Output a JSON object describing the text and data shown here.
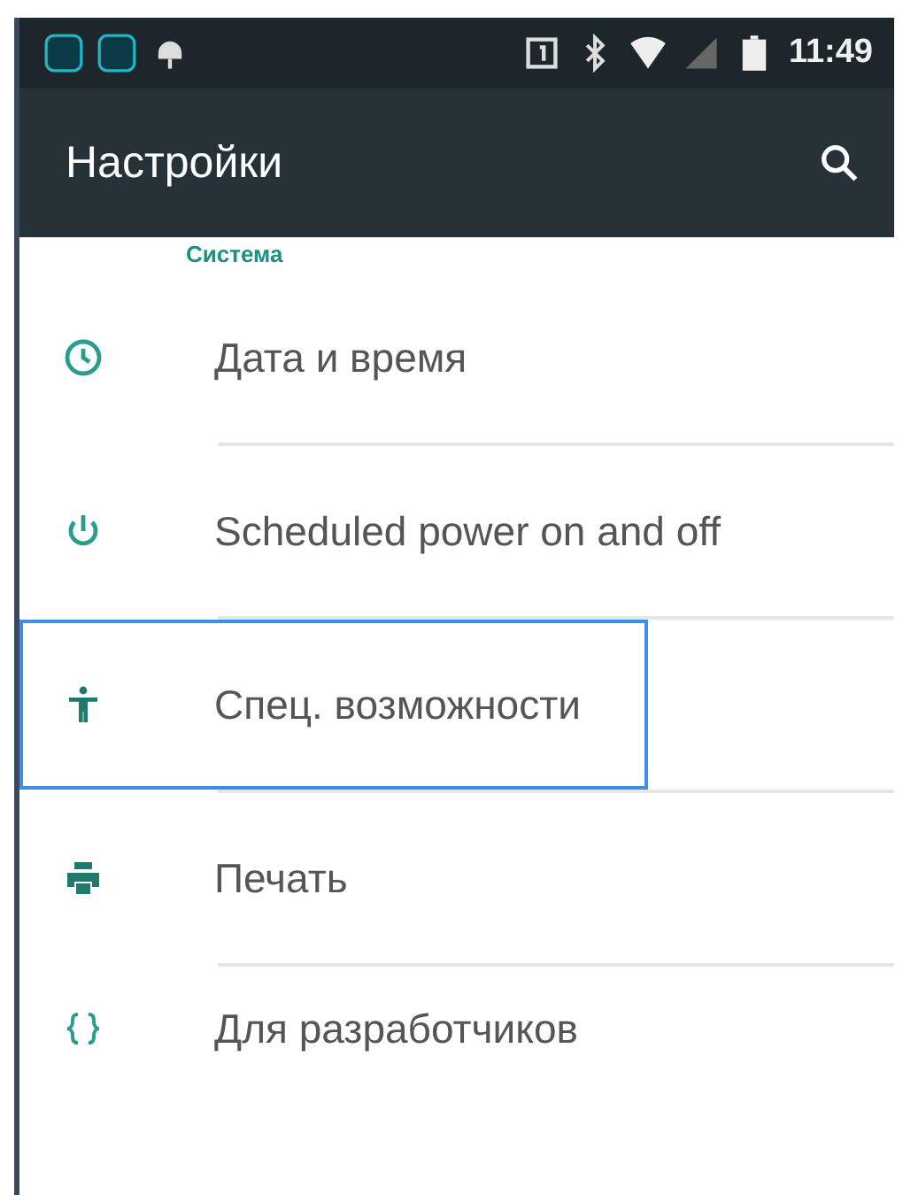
{
  "status_bar": {
    "time": "11:49"
  },
  "toolbar": {
    "title": "Настройки"
  },
  "section": {
    "title": "Система"
  },
  "items": [
    {
      "label": "Дата и время",
      "focused": false
    },
    {
      "label": "Scheduled power on and off",
      "focused": false
    },
    {
      "label": "Спец. возможности",
      "focused": true
    },
    {
      "label": "Печать",
      "focused": false
    },
    {
      "label": "Для разработчиков",
      "focused": false
    }
  ]
}
